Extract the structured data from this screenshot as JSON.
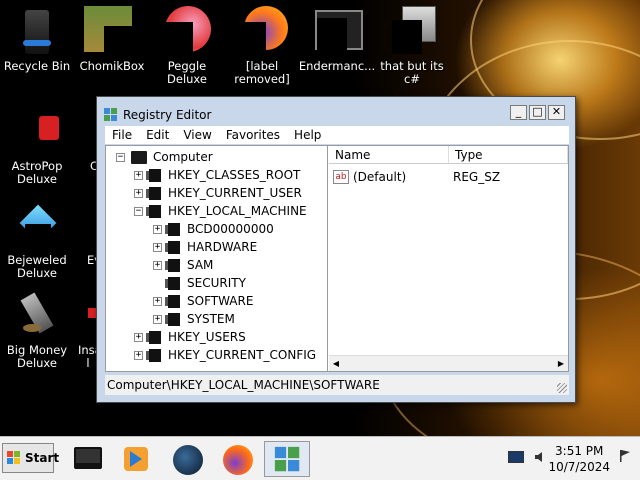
{
  "desktop": {
    "icons": [
      {
        "label": "Recycle Bin",
        "icon": "recycle-bin-icon"
      },
      {
        "label": "ChomikBox",
        "icon": "chomikbox-icon"
      },
      {
        "label": "Peggle Deluxe",
        "icon": "peggle-icon"
      },
      {
        "label": "[label removed]",
        "icon": "firefox-shortcut-icon"
      },
      {
        "label": "Endermanc...",
        "icon": "terminal-icon"
      },
      {
        "label": "that but its c#",
        "icon": "files-icon"
      },
      {
        "label": "AstroPop Deluxe",
        "icon": "astropop-icon"
      },
      {
        "label": "C",
        "icon": "partial-icon"
      },
      {
        "label": "Bejeweled Deluxe",
        "icon": "bejeweled-icon"
      },
      {
        "label": "Ev",
        "icon": "partial-icon"
      },
      {
        "label": "Big Money Deluxe",
        "icon": "big-money-icon"
      },
      {
        "label": "Insa",
        "icon": "partial-icon"
      },
      {
        "label": "l",
        "icon": "partial-icon"
      }
    ]
  },
  "window": {
    "title": "Registry Editor",
    "buttons": {
      "minimize": "_",
      "maximize": "□",
      "close": "✕"
    },
    "menu": [
      "File",
      "Edit",
      "View",
      "Favorites",
      "Help"
    ],
    "tree": [
      {
        "label": "Computer",
        "expander": "−",
        "level": 0,
        "icon": "computer-icon"
      },
      {
        "label": "HKEY_CLASSES_ROOT",
        "expander": "+",
        "level": 1
      },
      {
        "label": "HKEY_CURRENT_USER",
        "expander": "+",
        "level": 1
      },
      {
        "label": "HKEY_LOCAL_MACHINE",
        "expander": "−",
        "level": 1
      },
      {
        "label": "BCD00000000",
        "expander": "+",
        "level": 2
      },
      {
        "label": "HARDWARE",
        "expander": "+",
        "level": 2
      },
      {
        "label": "SAM",
        "expander": "+",
        "level": 2
      },
      {
        "label": "SECURITY",
        "expander": "",
        "level": 2
      },
      {
        "label": "SOFTWARE",
        "expander": "+",
        "level": 2
      },
      {
        "label": "SYSTEM",
        "expander": "+",
        "level": 2
      },
      {
        "label": "HKEY_USERS",
        "expander": "+",
        "level": 1
      },
      {
        "label": "HKEY_CURRENT_CONFIG",
        "expander": "+",
        "level": 1
      }
    ],
    "list": {
      "columns": [
        "Name",
        "Type"
      ],
      "rows": [
        {
          "icon": "ab",
          "name": "(Default)",
          "type": "REG_SZ"
        }
      ]
    },
    "status": "Computer\\HKEY_LOCAL_MACHINE\\SOFTWARE"
  },
  "taskbar": {
    "start_label": "Start",
    "apps": [
      "terminal-icon",
      "media-player-icon",
      "globe-icon",
      "firefox-icon",
      "regedit-icon"
    ],
    "clock": {
      "time": "3:51 PM",
      "date": "10/7/2024"
    },
    "tray": [
      "network-icon",
      "volume-icon",
      "flag-icon"
    ]
  }
}
